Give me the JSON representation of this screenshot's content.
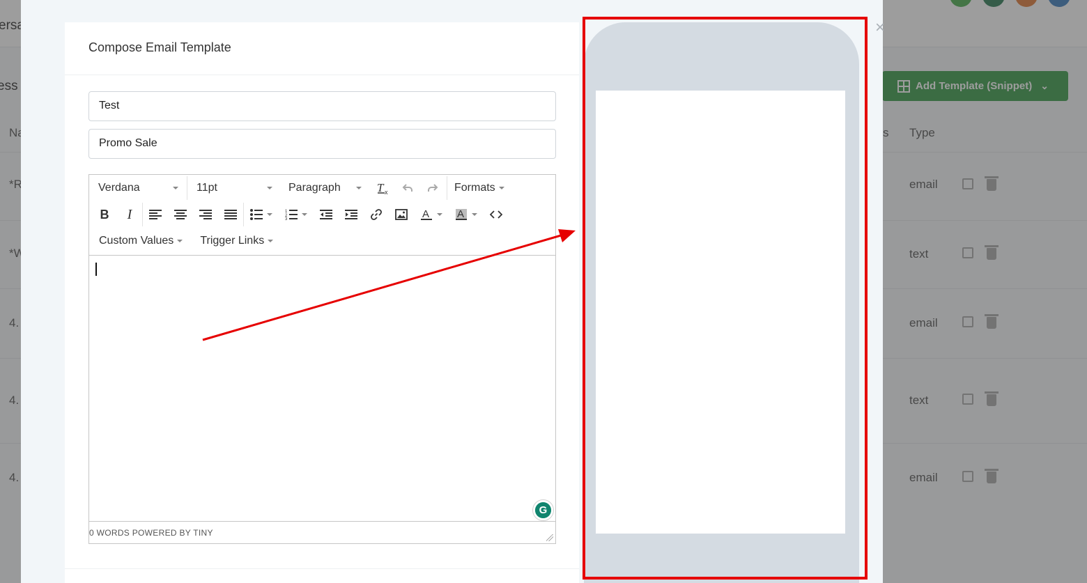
{
  "background": {
    "tab_fragment": "ersa",
    "heading_fragment": "ess",
    "add_template_button": "Add Template (Snippet)",
    "column_headers": {
      "name_fragment": "Na",
      "status_fragment": "s",
      "type": "Type"
    },
    "rows": [
      {
        "name_fragment": "*R",
        "type": "email"
      },
      {
        "name_fragment": "*W",
        "type": "text"
      },
      {
        "name_fragment": "4.",
        "type": "email"
      },
      {
        "name_fragment": "4.",
        "type": "text"
      },
      {
        "name_fragment": "4.",
        "type": "email"
      }
    ],
    "avatar_colors": [
      "#4caf50",
      "#2e7d57",
      "#e07b39",
      "#3f7fbf"
    ]
  },
  "modal": {
    "title": "Compose Email Template",
    "template_name_value": "Test",
    "subject_value": "Promo Sale",
    "editor": {
      "font_family": "Verdana",
      "font_size": "11pt",
      "block_format": "Paragraph",
      "formats_menu": "Formats",
      "custom_values_menu": "Custom Values",
      "trigger_links_menu": "Trigger Links",
      "status_text": "0 WORDS POWERED BY TINY"
    }
  },
  "annotation": {
    "color": "#e60000"
  },
  "colors": {
    "accent_green": "#3a9d4a",
    "phone_frame": "#d4dbe2",
    "modal_bg": "#f2f6f9"
  }
}
